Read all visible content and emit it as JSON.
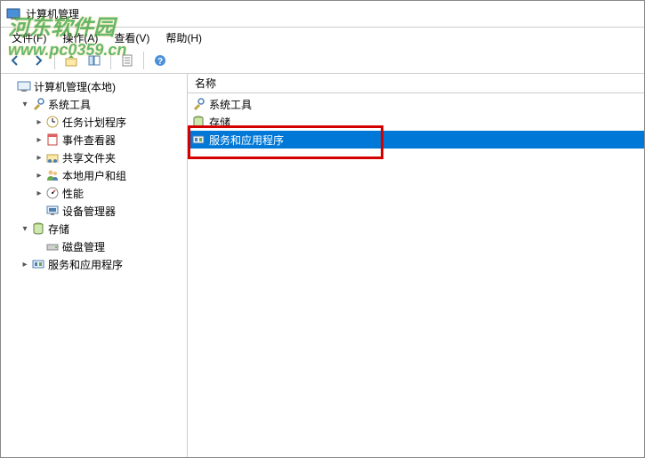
{
  "window": {
    "title": "计算机管理"
  },
  "menu": {
    "file": "文件(F)",
    "action": "操作(A)",
    "view": "查看(V)",
    "help": "帮助(H)"
  },
  "tree": {
    "root": "计算机管理(本地)",
    "system_tools": "系统工具",
    "task_scheduler": "任务计划程序",
    "event_viewer": "事件查看器",
    "shared_folders": "共享文件夹",
    "local_users": "本地用户和组",
    "performance": "性能",
    "device_manager": "设备管理器",
    "storage": "存储",
    "disk_management": "磁盘管理",
    "services_apps": "服务和应用程序"
  },
  "list": {
    "column_name": "名称",
    "items": {
      "system_tools": "系统工具",
      "storage": "存储",
      "services_apps": "服务和应用程序"
    }
  },
  "watermark": {
    "line1": "河东软件园",
    "line2": "www.pc0359.cn"
  }
}
